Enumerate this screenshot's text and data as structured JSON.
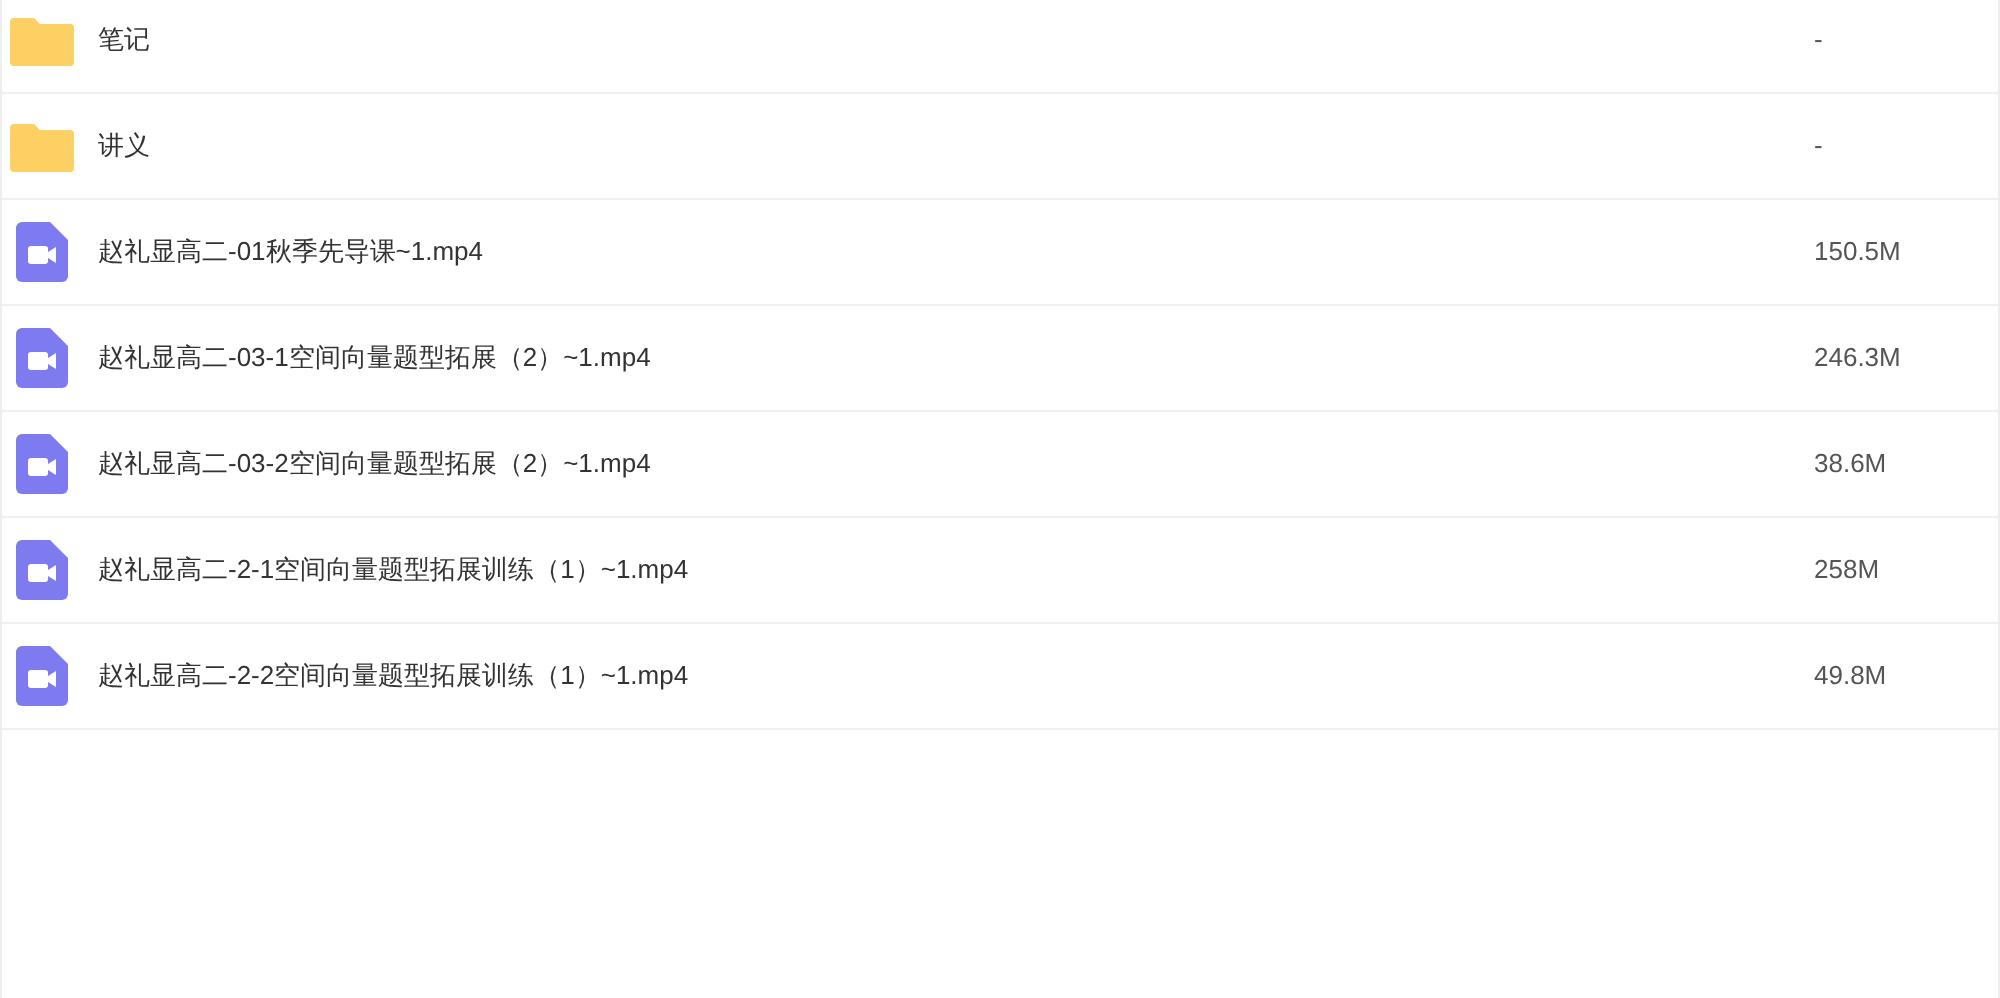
{
  "files": [
    {
      "kind": "folder",
      "name": "笔记",
      "size": "-"
    },
    {
      "kind": "folder",
      "name": "讲义",
      "size": "-"
    },
    {
      "kind": "video",
      "name": "赵礼显高二-01秋季先导课~1.mp4",
      "size": "150.5M"
    },
    {
      "kind": "video",
      "name": "赵礼显高二-03-1空间向量题型拓展（2）~1.mp4",
      "size": "246.3M"
    },
    {
      "kind": "video",
      "name": "赵礼显高二-03-2空间向量题型拓展（2）~1.mp4",
      "size": "38.6M"
    },
    {
      "kind": "video",
      "name": "赵礼显高二-2-1空间向量题型拓展训练（1）~1.mp4",
      "size": "258M"
    },
    {
      "kind": "video",
      "name": "赵礼显高二-2-2空间向量题型拓展训练（1）~1.mp4",
      "size": "49.8M"
    }
  ]
}
